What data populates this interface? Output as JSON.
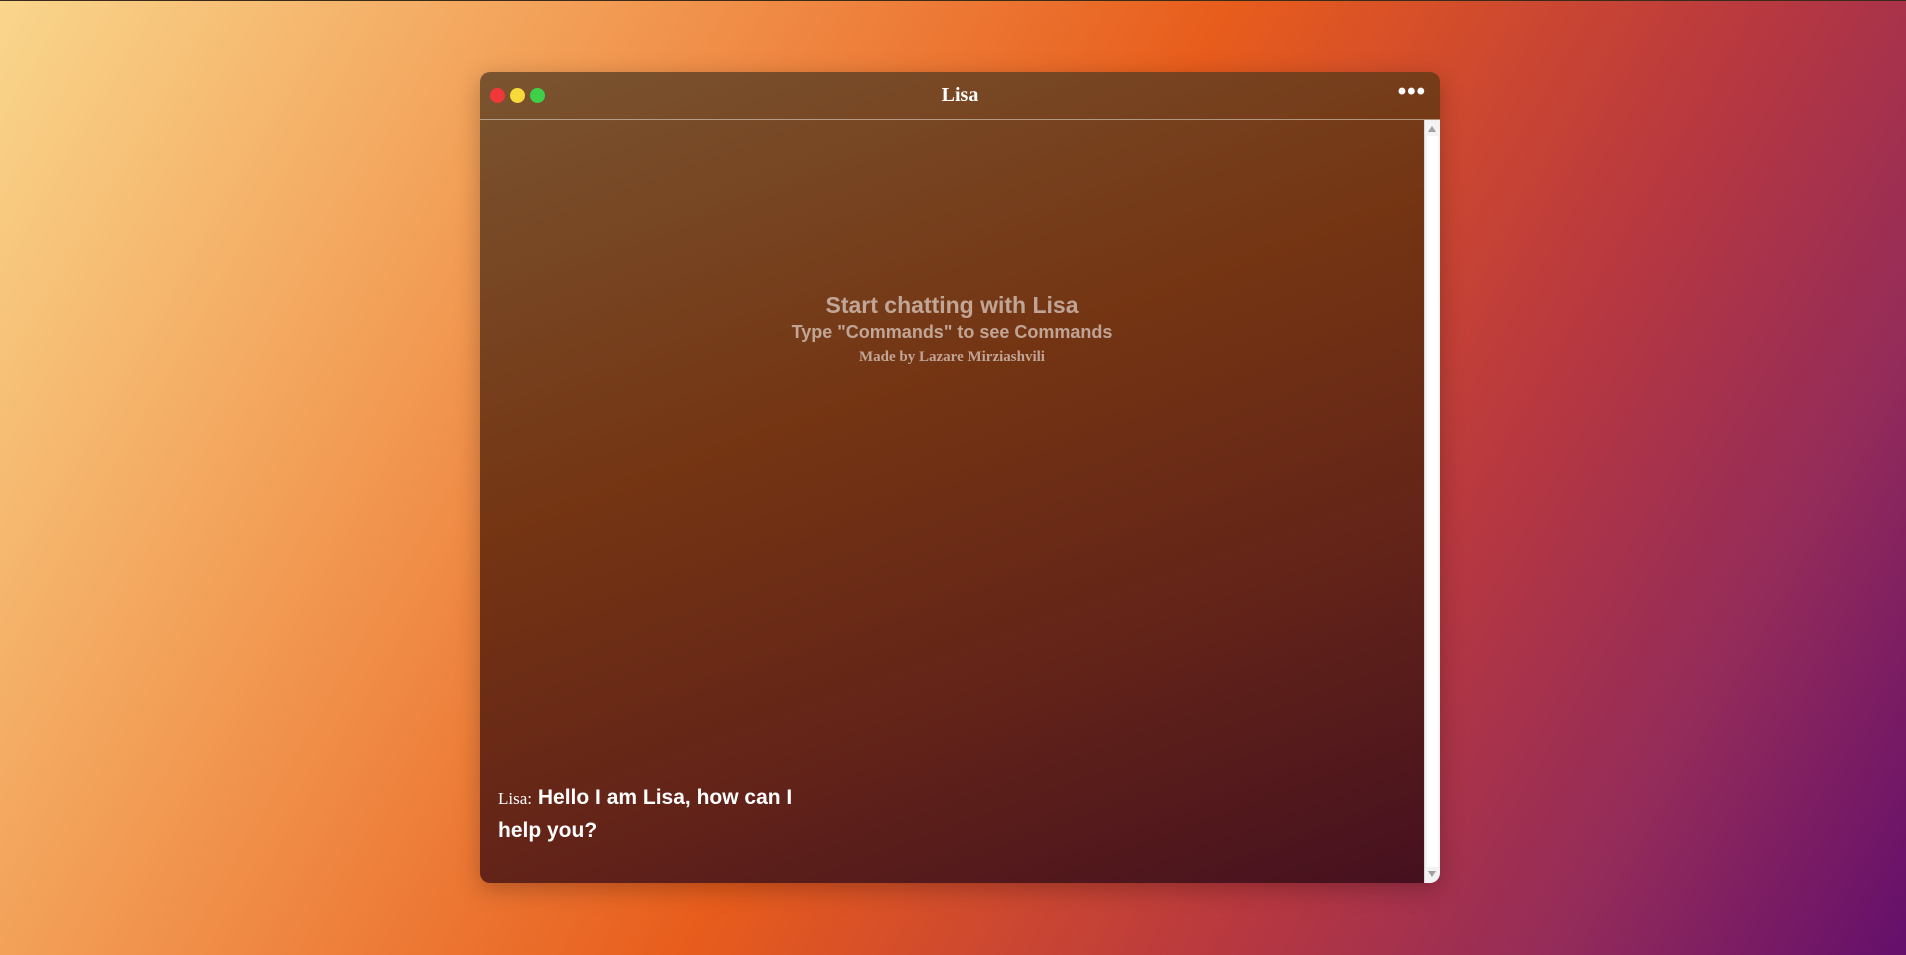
{
  "window": {
    "title": "Lisa",
    "more_icon": "ellipsis-icon",
    "more_label": "•••"
  },
  "intro": {
    "title": "Start chatting with Lisa",
    "subtitle": "Type \"Commands\" to see Commands",
    "credit": "Made by Lazare Mirziashvili"
  },
  "messages": [
    {
      "sender": "Lisa:",
      "text": "Hello I am Lisa, how can I help you?"
    }
  ],
  "input": {
    "value": "",
    "placeholder": "",
    "send_icon": "arrow-up-icon"
  },
  "colors": {
    "close": "#f0383a",
    "minimize": "#f7d93a",
    "maximize": "#3fd04a",
    "input_bg": "#e2d6d9"
  }
}
